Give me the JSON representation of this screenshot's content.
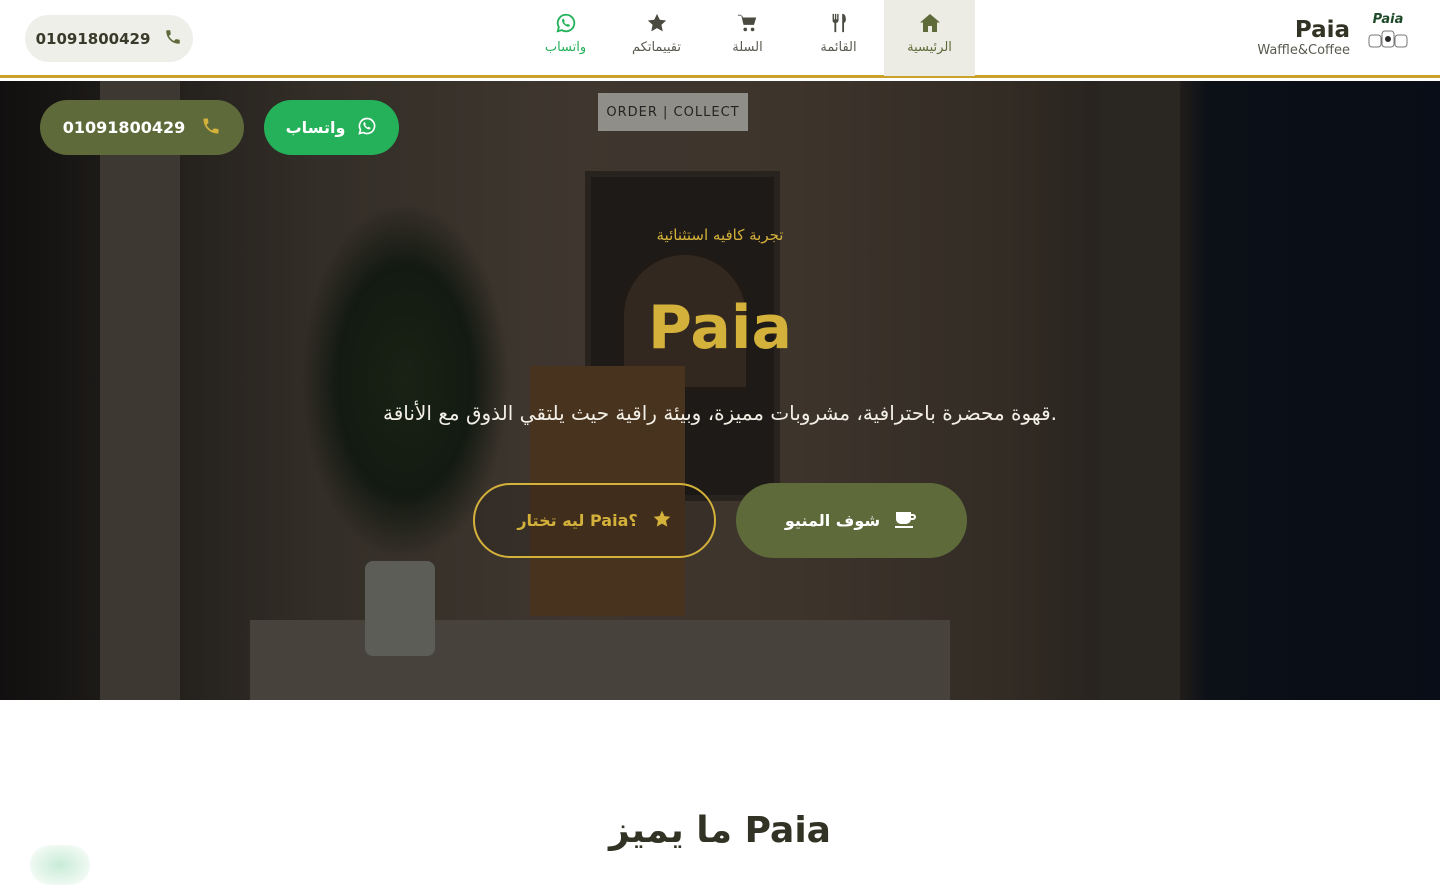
{
  "header": {
    "phone": "01091800429",
    "brand_name": "Paia",
    "brand_sub": "Waffle&Coffee",
    "logo_text": "Paia",
    "nav": [
      {
        "label": "واتساب",
        "icon": "whatsapp-icon"
      },
      {
        "label": "تقييماتكم",
        "icon": "star-icon"
      },
      {
        "label": "السلة",
        "icon": "cart-icon"
      },
      {
        "label": "القائمة",
        "icon": "utensils-icon"
      },
      {
        "label": "الرئيسية",
        "icon": "home-icon",
        "active": true
      }
    ]
  },
  "hero": {
    "sign_text": "ORDER | COLLECT",
    "phone_button": "01091800429",
    "whatsapp_button": "واتساب",
    "kicker": "تجربة كافيه استثنائية",
    "title": "Paia",
    "description": "قهوة محضرة باحترافية، مشروبات مميزة، وبيئة راقية حيث يلتقي الذوق مع الأناقة.",
    "why_button": "ليه تختار Paia؟",
    "menu_button": "شوف المنيو"
  },
  "features": {
    "title": "ما يميز Paia"
  },
  "colors": {
    "olive": "#5f6a3a",
    "gold": "#d4b13a",
    "whatsapp": "#25b15a"
  }
}
